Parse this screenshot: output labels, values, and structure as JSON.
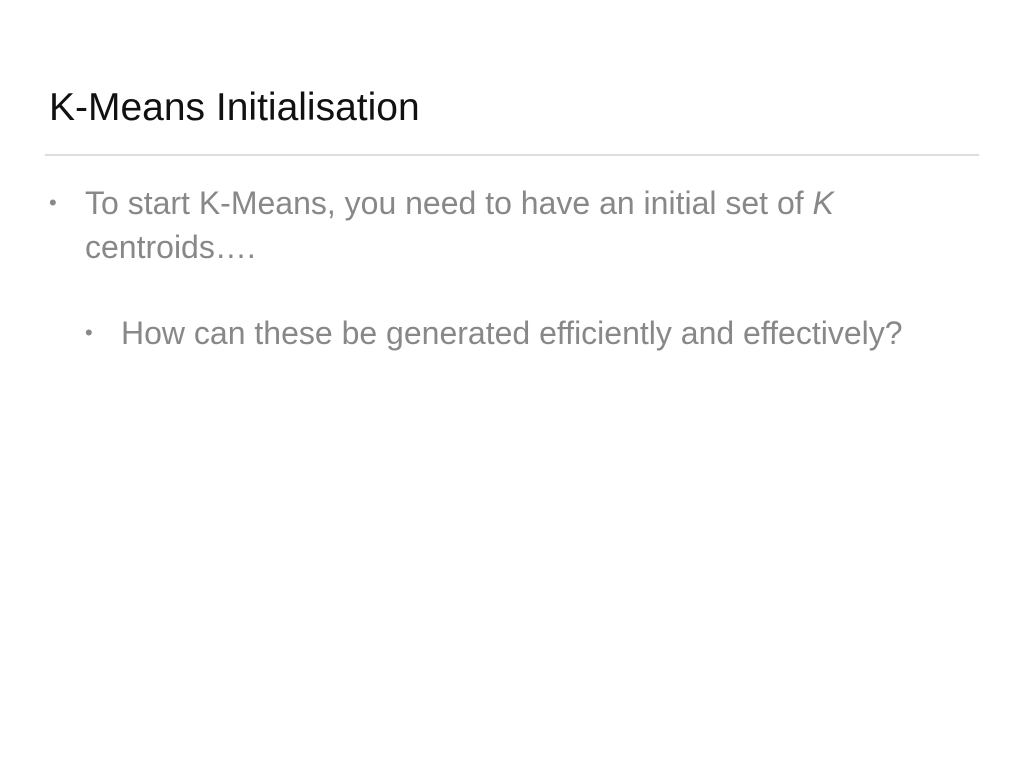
{
  "slide": {
    "title": "K-Means Initialisation",
    "bullets": [
      {
        "text_before": "To start K-Means, you need to have an initial set of ",
        "text_italic": "K",
        "text_after": " centroids…."
      }
    ],
    "sub_bullets": [
      {
        "text": "How can these be generated efficiently and effectively?"
      }
    ],
    "colors": {
      "title": "#111111",
      "body": "#888888",
      "rule": "#dddddd",
      "background": "#ffffff"
    }
  }
}
